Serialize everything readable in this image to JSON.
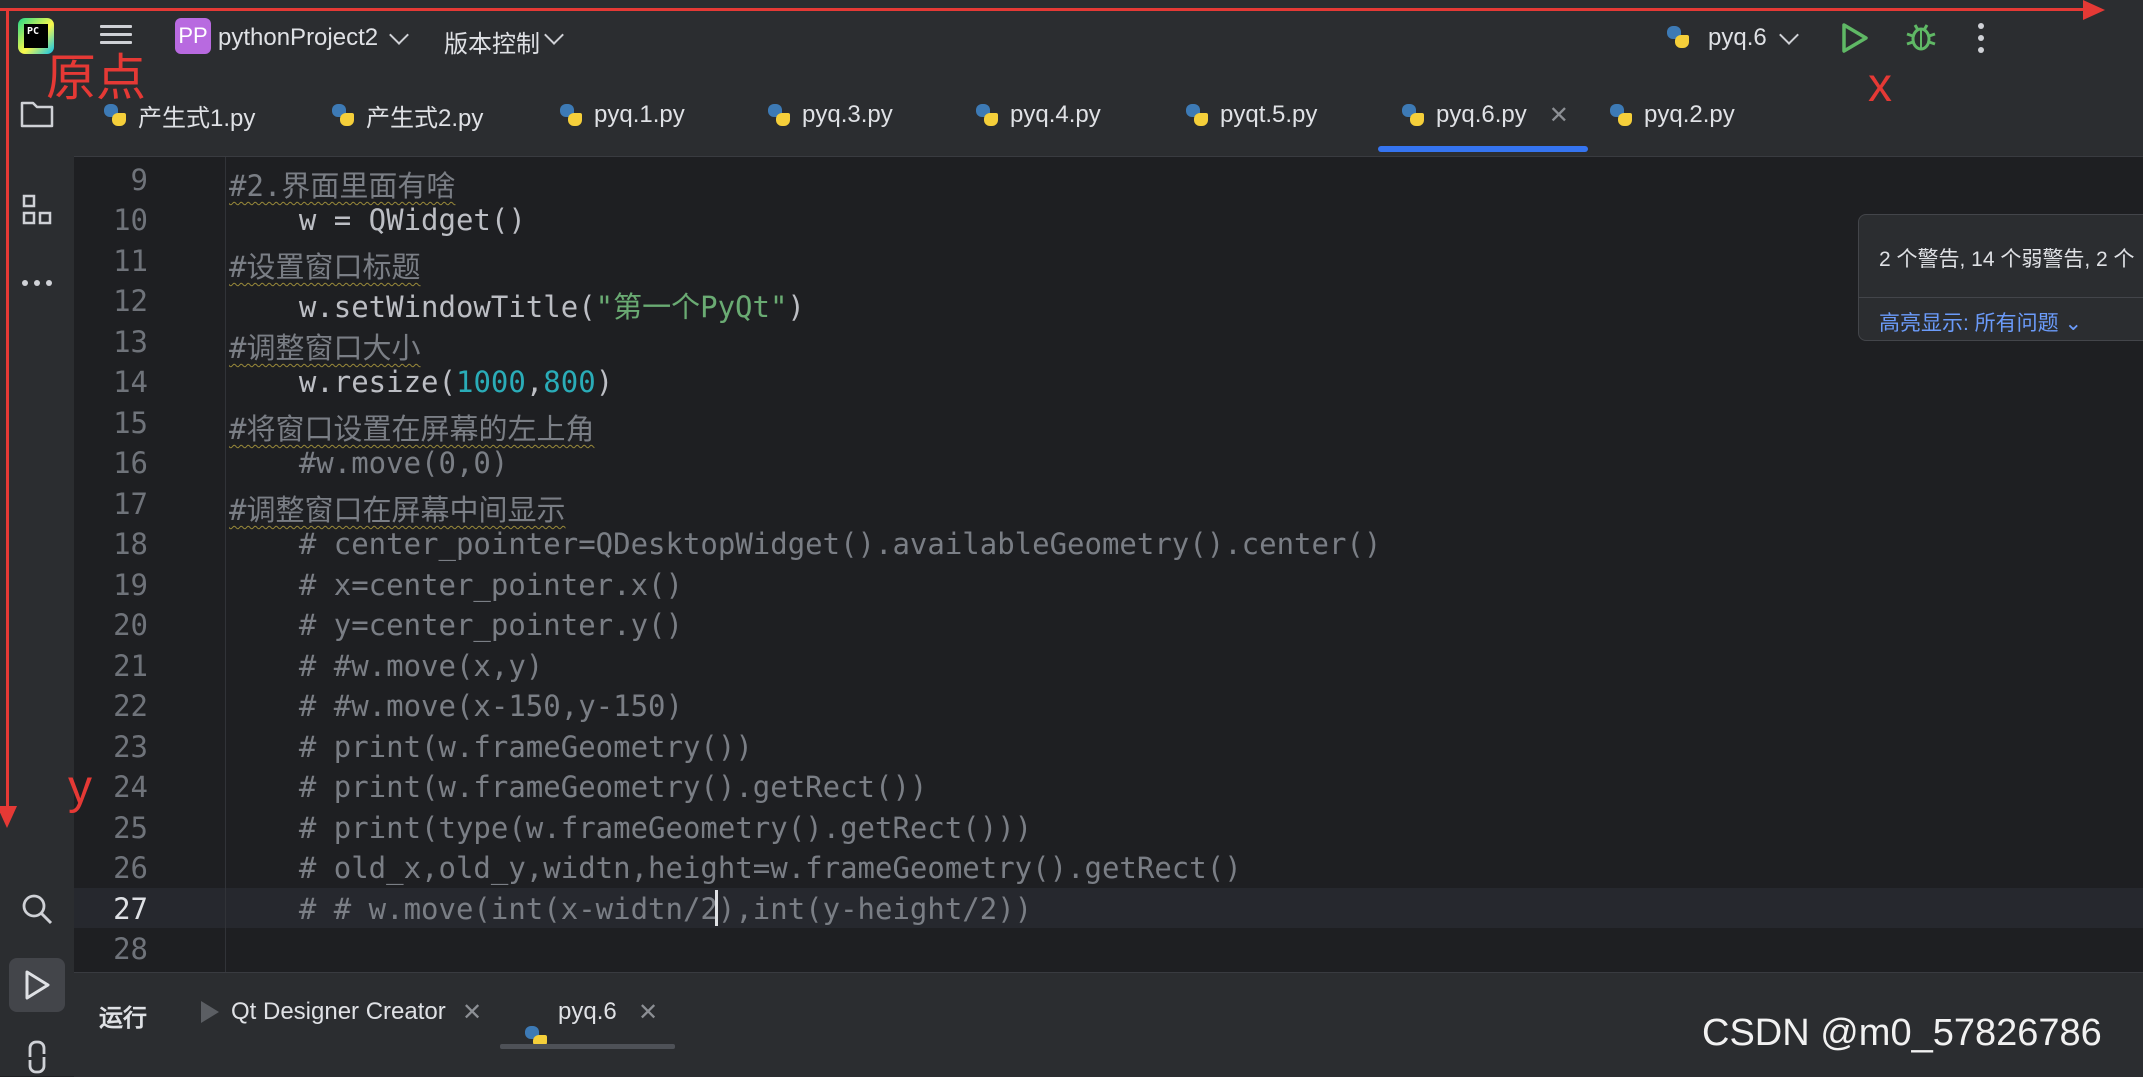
{
  "titlebar": {
    "logo_text": "PC",
    "project_badge": "PP",
    "project_name": "pythonProject2",
    "vcs_label": "版本控制",
    "run_config": "pyq.6"
  },
  "tabs": [
    {
      "label": "产生式1.py"
    },
    {
      "label": "产生式2.py"
    },
    {
      "label": "pyq.1.py"
    },
    {
      "label": "pyq.3.py"
    },
    {
      "label": "pyq.4.py"
    },
    {
      "label": "pyqt.5.py"
    },
    {
      "label": "pyq.6.py",
      "active": true
    },
    {
      "label": "pyq.2.py"
    }
  ],
  "editor": {
    "line_numbers": [
      "9",
      "10",
      "11",
      "12",
      "13",
      "14",
      "15",
      "16",
      "17",
      "18",
      "19",
      "20",
      "21",
      "22",
      "23",
      "24",
      "25",
      "26",
      "27",
      "28"
    ],
    "current_line": "27",
    "lines": {
      "l9": "#2.界面里面有啥",
      "l10": "    w = QWidget()",
      "l11": "#设置窗口标题",
      "l12_a": "    w.setWindowTitle(",
      "l12_b": "\"第一个PyQt\"",
      "l12_c": ")",
      "l13": "#调整窗口大小",
      "l14_a": "    w.resize(",
      "l14_b": "1000",
      "l14_c": ",",
      "l14_d": "800",
      "l14_e": ")",
      "l15": "#将窗口设置在屏幕的左上角",
      "l16": "    #w.move(0,0)",
      "l17": "#调整窗口在屏幕中间显示",
      "l18": "    # center_pointer=QDesktopWidget().availableGeometry().center()",
      "l19": "    # x=center_pointer.x()",
      "l20": "    # y=center_pointer.y()",
      "l21": "    # #w.move(x,y)",
      "l22": "    # #w.move(x-150,y-150)",
      "l23": "    # print(w.frameGeometry())",
      "l24": "    # print(w.frameGeometry().getRect())",
      "l25": "    # print(type(w.frameGeometry().getRect()))",
      "l26": "    # old_x,old_y,widtn,height=w.frameGeometry().getRect()",
      "l27": "    # # w.move(int(x-widtn/2),int(y-height/2))",
      "l28": ""
    }
  },
  "inspection": {
    "summary": "2 个警告, 14 个弱警告, 2 个",
    "highlight": "高亮显示: 所有问题"
  },
  "bottom_panel": {
    "run_label": "运行",
    "tabs": [
      {
        "label": "Qt Designer Creator"
      },
      {
        "label": "pyq.6"
      }
    ]
  },
  "annotations": {
    "origin": "原点",
    "x": "x",
    "y": "y",
    "color": "#e53935"
  },
  "watermark": "CSDN @m0_57826786",
  "colors": {
    "accent": "#3574f0",
    "string": "#6aab73",
    "number": "#2aacb8",
    "comment": "#7a7e85",
    "run_green": "#5fb865"
  }
}
